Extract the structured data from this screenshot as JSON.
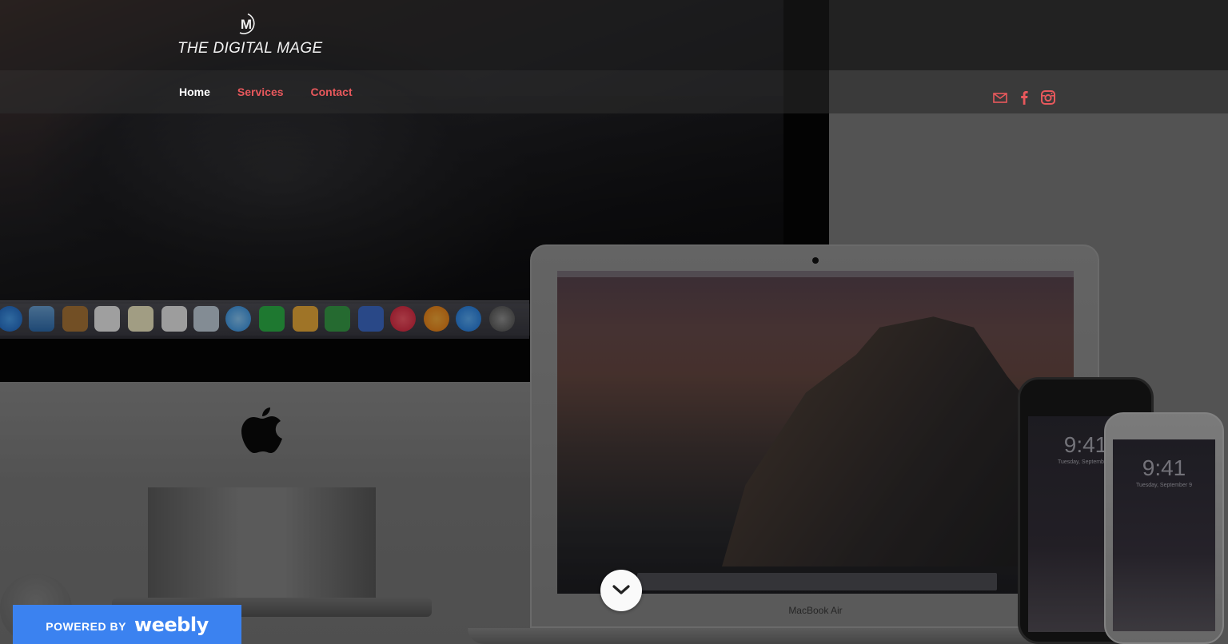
{
  "header": {
    "logo_mark": "M",
    "logo_text": "THE DIGITAL MAGE"
  },
  "nav": {
    "items": [
      {
        "label": "Home",
        "active": true
      },
      {
        "label": "Services",
        "active": false
      },
      {
        "label": "Contact",
        "active": false
      }
    ]
  },
  "social": {
    "icons": [
      "mail-icon",
      "facebook-icon",
      "instagram-icon"
    ],
    "color": "#e8585c"
  },
  "hero": {
    "macbook_label": "MacBook Air",
    "phone_time": "9:41",
    "phone_date": "Tuesday, September 9"
  },
  "footer_badge": {
    "powered_by": "POWERED BY",
    "brand": "weebly",
    "color": "#3b82f0"
  },
  "colors": {
    "accent": "#e8585c",
    "nav_active": "#ffffff",
    "header_dark": "#222222",
    "nav_bar": "#3a3a3a"
  }
}
